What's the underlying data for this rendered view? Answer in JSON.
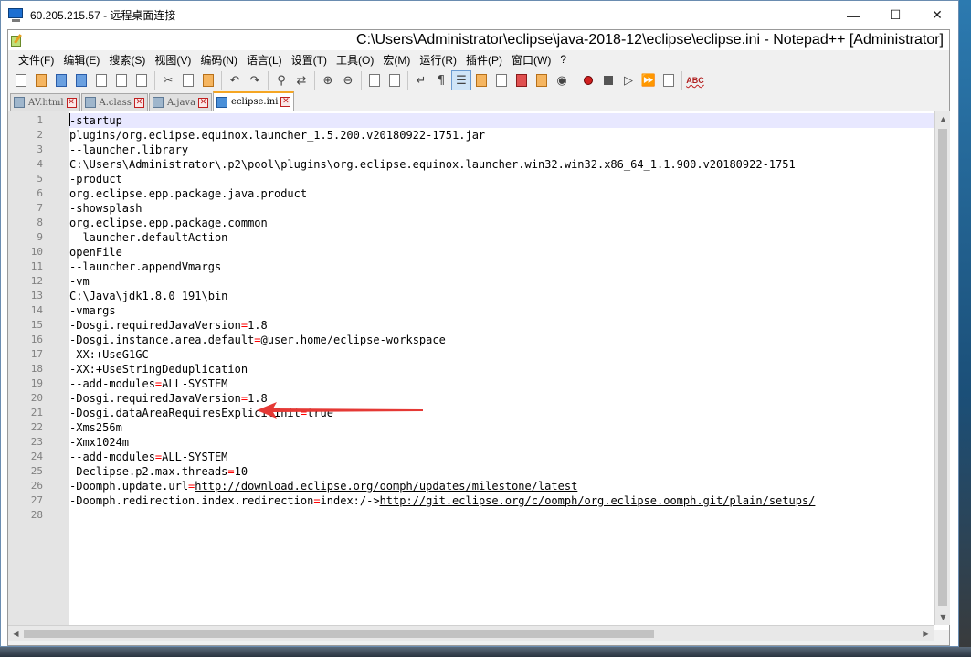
{
  "rdp": {
    "title": "60.205.215.57 - 远程桌面连接",
    "controls": [
      "—",
      "☐",
      "✕"
    ]
  },
  "npp": {
    "title": "C:\\Users\\Administrator\\eclipse\\java-2018-12\\eclipse\\eclipse.ini - Notepad++ [Administrator]",
    "menu": [
      "文件(F)",
      "编辑(E)",
      "搜索(S)",
      "视图(V)",
      "编码(N)",
      "语言(L)",
      "设置(T)",
      "工具(O)",
      "宏(M)",
      "运行(R)",
      "插件(P)",
      "窗口(W)",
      "?"
    ],
    "tabs": [
      {
        "label": "AV.html",
        "active": false
      },
      {
        "label": "A.class",
        "active": false
      },
      {
        "label": "A.java",
        "active": false
      },
      {
        "label": "eclipse.ini",
        "active": true
      }
    ],
    "toolbar_icons": [
      "new-file-icon",
      "open-file-icon",
      "save-icon",
      "save-all-icon",
      "close-icon",
      "close-all-icon",
      "print-icon",
      "cut-icon",
      "copy-icon",
      "paste-icon",
      "undo-icon",
      "redo-icon",
      "find-icon",
      "replace-icon",
      "zoom-in-icon",
      "zoom-out-icon",
      "sync-vertical-icon",
      "sync-horizontal-icon",
      "word-wrap-icon",
      "show-all-chars-icon",
      "indent-guide-icon",
      "udl-icon",
      "doc-map-icon",
      "function-list-icon",
      "folder-workspace-icon",
      "monitoring-icon",
      "record-macro-icon",
      "stop-macro-icon",
      "play-macro-icon",
      "run-macro-multiple-icon",
      "save-macro-icon",
      "spellcheck-icon"
    ]
  },
  "editor": {
    "current_line": 1,
    "lines": [
      "-startup",
      "plugins/org.eclipse.equinox.launcher_1.5.200.v20180922-1751.jar",
      "--launcher.library",
      "C:\\Users\\Administrator\\.p2\\pool\\plugins\\org.eclipse.equinox.launcher.win32.win32.x86_64_1.1.900.v20180922-1751",
      "-product",
      "org.eclipse.epp.package.java.product",
      "-showsplash",
      "org.eclipse.epp.package.common",
      "--launcher.defaultAction",
      "openFile",
      "--launcher.appendVmargs",
      "-vm",
      "C:\\Java\\jdk1.8.0_191\\bin",
      "-vmargs",
      "-Dosgi.requiredJavaVersion=1.8",
      "-Dosgi.instance.area.default=@user.home/eclipse-workspace",
      "-XX:+UseG1GC",
      "-XX:+UseStringDeduplication",
      "--add-modules=ALL-SYSTEM",
      "-Dosgi.requiredJavaVersion=1.8",
      "-Dosgi.dataAreaRequiresExplicitInit=true",
      "-Xms256m",
      "-Xmx1024m",
      "--add-modules=ALL-SYSTEM",
      "-Declipse.p2.max.threads=10",
      "-Doomph.update.url=http://download.eclipse.org/oomph/updates/milestone/latest",
      "-Doomph.redirection.index.redirection=index:/->http://git.eclipse.org/c/oomph/org.eclipse.oomph.git/plain/setups/",
      ""
    ],
    "line_numbers": [
      "1",
      "2",
      "3",
      "4",
      "5",
      "6",
      "7",
      "8",
      "9",
      "10",
      "11",
      "12",
      "13",
      "14",
      "15",
      "16",
      "17",
      "18",
      "19",
      "20",
      "21",
      "22",
      "23",
      "24",
      "25",
      "26",
      "27",
      "28"
    ]
  },
  "annotation": {
    "arrow_color": "#e53935",
    "points_to_line": 13
  }
}
